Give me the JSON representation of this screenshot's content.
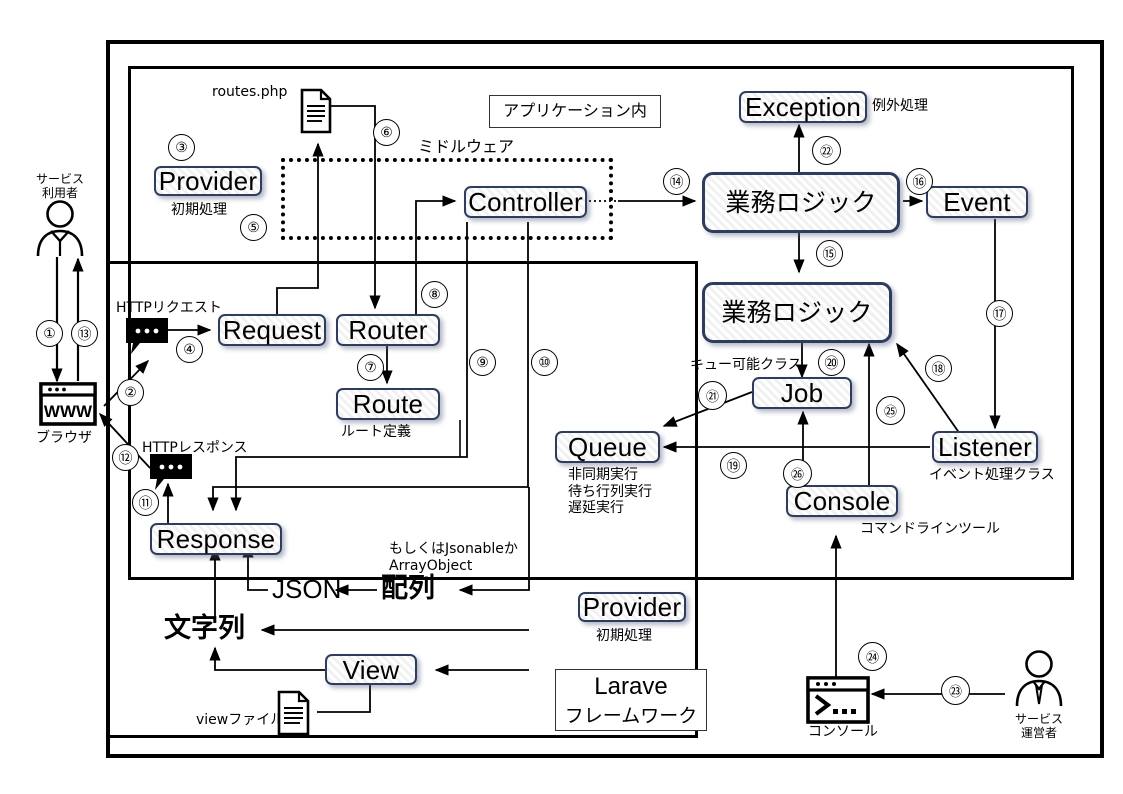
{
  "diagram": {
    "title_note": "Laravel request lifecycle diagram",
    "frames": {
      "app_inner_label": "アプリケーション内",
      "framework_label_line1": "Larave",
      "framework_label_line2": "フレームワーク",
      "middleware_label": "ミドルウェア"
    },
    "actors": {
      "service_user": "サービス\n利用者",
      "service_operator": "サービス\n運営者",
      "browser": "ブラウザ",
      "console_device": "コンソール"
    },
    "files": {
      "routes_php": "routes.php",
      "view_file": "viewファイル"
    },
    "messages": {
      "http_request": "HTTPリクエスト",
      "http_response": "HTTPレスポンス"
    },
    "nodes": [
      {
        "id": "provider_top",
        "label": "Provider",
        "note": "初期処理"
      },
      {
        "id": "request",
        "label": "Request",
        "note": ""
      },
      {
        "id": "router",
        "label": "Router",
        "note": ""
      },
      {
        "id": "route",
        "label": "Route",
        "note": "ルート定義"
      },
      {
        "id": "controller",
        "label": "Controller",
        "note": ""
      },
      {
        "id": "exception",
        "label": "Exception",
        "note": "例外処理"
      },
      {
        "id": "logic_top",
        "label": "業務ロジック",
        "note": ""
      },
      {
        "id": "logic_bottom",
        "label": "業務ロジック",
        "note": ""
      },
      {
        "id": "event",
        "label": "Event",
        "note": ""
      },
      {
        "id": "listener",
        "label": "Listener",
        "note": "イベント処理クラス"
      },
      {
        "id": "job",
        "label": "Job",
        "note": "キュー可能クラス"
      },
      {
        "id": "queue",
        "label": "Queue",
        "note": "非同期実行\n待ち行列実行\n遅延実行"
      },
      {
        "id": "console",
        "label": "Console",
        "note": "コマンドラインツール"
      },
      {
        "id": "response",
        "label": "Response",
        "note": ""
      },
      {
        "id": "view",
        "label": "View",
        "note": ""
      },
      {
        "id": "provider_bottom",
        "label": "Provider",
        "note": "初期処理"
      }
    ],
    "plain_texts": {
      "json": "JSON",
      "array": "配列",
      "string": "文字列",
      "array_note": "もしくはJsonableか\nArrayObject"
    },
    "step_numbers": [
      {
        "n": "①",
        "meaning": "user to browser"
      },
      {
        "n": "②",
        "meaning": "browser to http request"
      },
      {
        "n": "③",
        "meaning": "provider init"
      },
      {
        "n": "④",
        "meaning": "http request to Request"
      },
      {
        "n": "⑤",
        "meaning": "middleware"
      },
      {
        "n": "⑥",
        "meaning": "routes.php to Router"
      },
      {
        "n": "⑦",
        "meaning": "Router to Route"
      },
      {
        "n": "⑧",
        "meaning": "Route to Controller"
      },
      {
        "n": "⑨",
        "meaning": "Controller to Response"
      },
      {
        "n": "⑩",
        "meaning": "Controller to Response alt"
      },
      {
        "n": "⑪",
        "meaning": "Response to http response"
      },
      {
        "n": "⑫",
        "meaning": "http response to browser"
      },
      {
        "n": "⑬",
        "meaning": "browser to user"
      },
      {
        "n": "⑭",
        "meaning": "Controller to business logic"
      },
      {
        "n": "⑮",
        "meaning": "logic to logic"
      },
      {
        "n": "⑯",
        "meaning": "logic to Event"
      },
      {
        "n": "⑰",
        "meaning": "Event to Listener"
      },
      {
        "n": "⑱",
        "meaning": "Listener to business logic"
      },
      {
        "n": "⑲",
        "meaning": "Listener to Queue"
      },
      {
        "n": "⑳",
        "meaning": "logic to Job"
      },
      {
        "n": "㉑",
        "meaning": "Job to Queue"
      },
      {
        "n": "㉒",
        "meaning": "logic to Exception"
      },
      {
        "n": "㉓",
        "meaning": "operator to console"
      },
      {
        "n": "㉔",
        "meaning": "console device to Console"
      },
      {
        "n": "㉕",
        "meaning": "Console to business logic"
      },
      {
        "n": "㉖",
        "meaning": "Console to Job"
      }
    ]
  }
}
